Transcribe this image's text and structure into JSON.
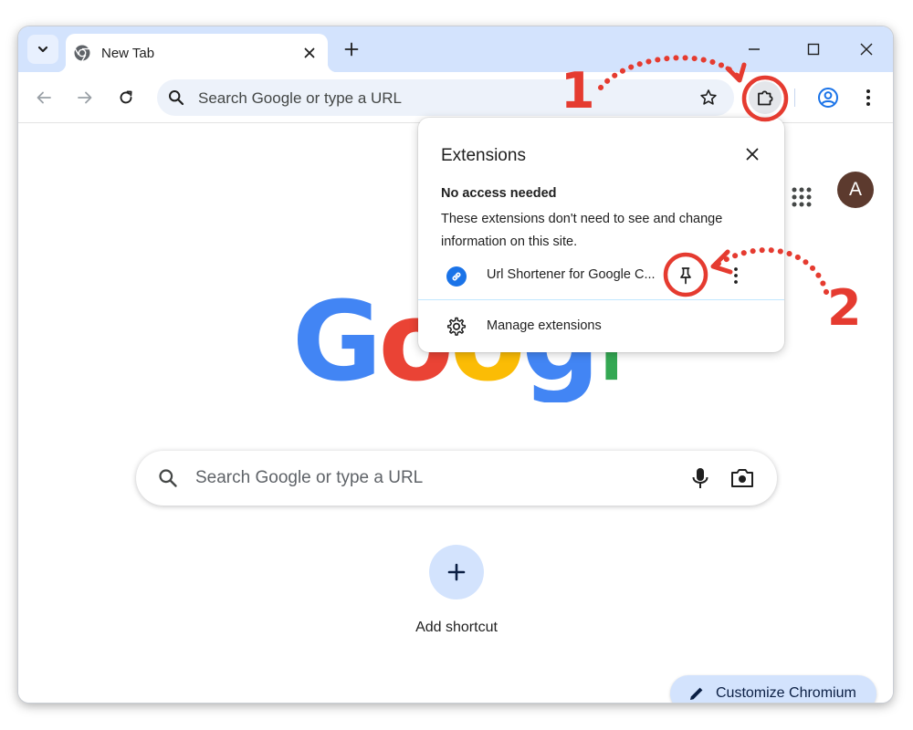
{
  "tab": {
    "title": "New Tab",
    "favicon": "chromium-icon",
    "close_icon": "close-icon"
  },
  "tabstrip": {
    "search_icon": "chevron-down-icon",
    "new_tab_icon": "plus-icon",
    "window_controls": [
      "minimize-icon",
      "maximize-icon",
      "close-icon"
    ]
  },
  "toolbar": {
    "back_icon": "arrow-left-icon",
    "forward_icon": "arrow-right-icon",
    "reload_icon": "reload-icon",
    "omnibox_placeholder": "Search Google or type a URL",
    "bookmark_icon": "star-icon",
    "extensions_icon": "puzzle-icon",
    "profile_icon": "account-circle-icon",
    "menu_icon": "more-vertical-icon"
  },
  "ntp": {
    "apps_icon": "apps-grid-icon",
    "avatar_letter": "A",
    "logo_text": "Google",
    "search_placeholder": "Search Google or type a URL",
    "mic_icon": "microphone-icon",
    "lens_icon": "camera-icon",
    "add_shortcut_label": "Add shortcut",
    "customize_label": "Customize Chromium",
    "customize_icon": "pencil-icon"
  },
  "extensions_popup": {
    "title": "Extensions",
    "section_heading": "No access needed",
    "section_description": "These extensions don't need to see and change information on this site.",
    "items": [
      {
        "name": "Url Shortener for Google C...",
        "icon": "link-icon",
        "pin_icon": "pin-icon",
        "more_icon": "more-vertical-icon"
      }
    ],
    "manage_label": "Manage extensions",
    "manage_icon": "gear-icon"
  },
  "annotations": {
    "step_1": "1",
    "step_2": "2",
    "color": "#e53b30"
  },
  "colors": {
    "tabstrip_bg": "#d3e3fd",
    "omnibox_bg": "#edf2fa",
    "accent_blue": "#1a73e8",
    "google_blue": "#4285f4",
    "google_red": "#ea4335",
    "google_yellow": "#fbbc05",
    "google_green": "#34a853"
  }
}
